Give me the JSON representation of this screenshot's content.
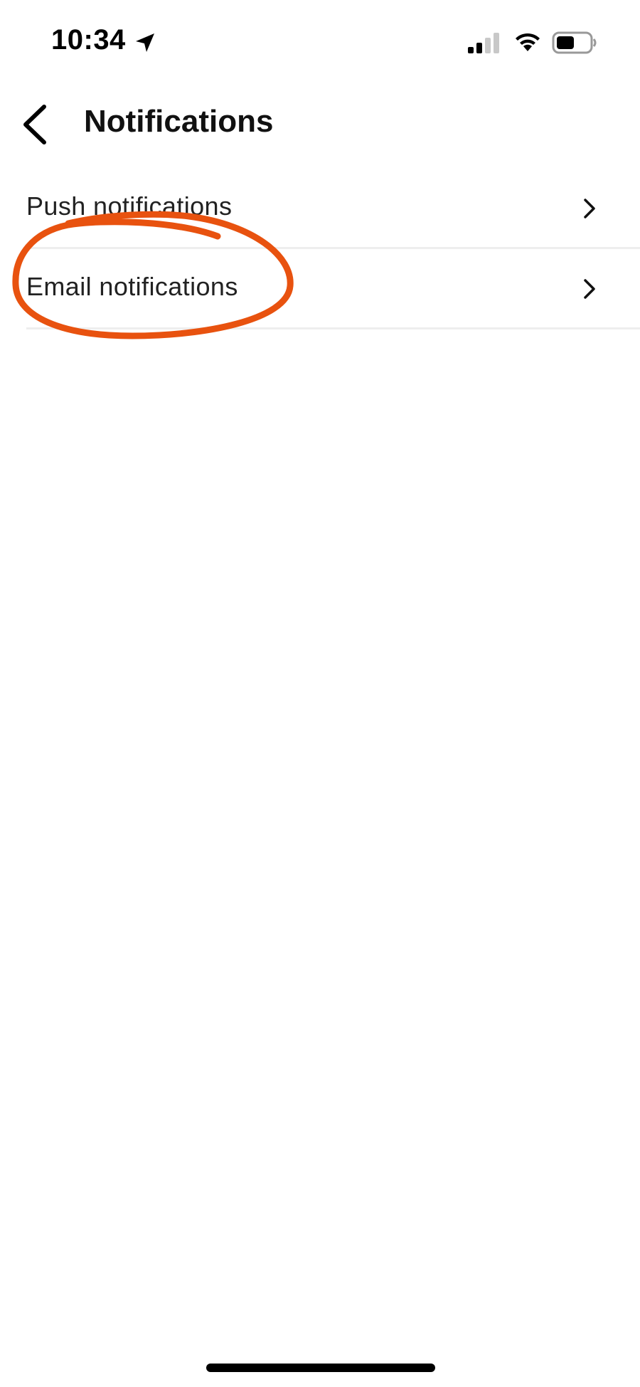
{
  "status_bar": {
    "time": "10:34",
    "icons": [
      "location-arrow-icon",
      "cellular-signal-icon",
      "wifi-icon",
      "battery-icon"
    ]
  },
  "header": {
    "title": "Notifications",
    "back_icon": "chevron-left-icon"
  },
  "list": {
    "items": [
      {
        "label": "Push notifications",
        "icon": "chevron-right-icon"
      },
      {
        "label": "Email notifications",
        "icon": "chevron-right-icon"
      }
    ]
  },
  "annotation": {
    "shape": "hand-drawn-ellipse",
    "color": "#E8520F",
    "target": "Email notifications"
  },
  "colors": {
    "background": "#FFFFFF",
    "text": "#222222",
    "divider": "#EEEEEE"
  }
}
